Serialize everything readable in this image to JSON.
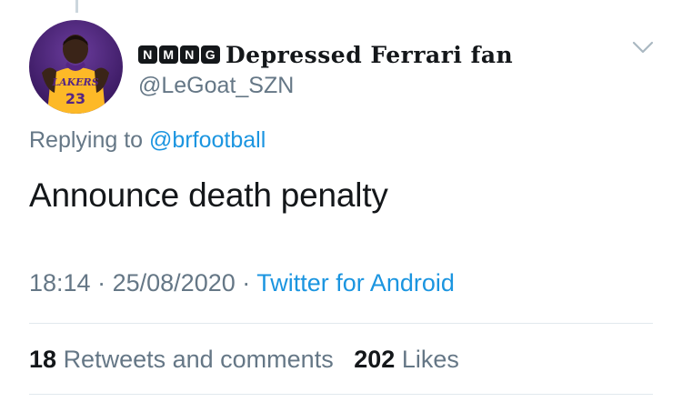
{
  "user": {
    "badges": [
      "N",
      "M",
      "N",
      "G"
    ],
    "display_name": "Depressed Ferrari fan",
    "handle": "@LeGoat_SZN",
    "avatar_jersey_text": "LAKERS",
    "avatar_number": "23"
  },
  "reply": {
    "prefix": "Replying to",
    "mention": "@brfootball"
  },
  "tweet": {
    "text": "Announce death penalty"
  },
  "meta": {
    "time": "18:14",
    "sep1": "·",
    "date": "25/08/2020",
    "sep2": "·",
    "source": "Twitter for Android"
  },
  "stats": {
    "retweets_count": "18",
    "retweets_label": "Retweets and comments",
    "likes_count": "202",
    "likes_label": "Likes"
  },
  "colors": {
    "link": "#1b95e0",
    "secondary_text": "#657786",
    "divider": "#e1e8ed",
    "avatar_purple": "#552583",
    "lakers_gold": "#fdb927"
  },
  "icons": [
    "chevron-down-icon"
  ]
}
